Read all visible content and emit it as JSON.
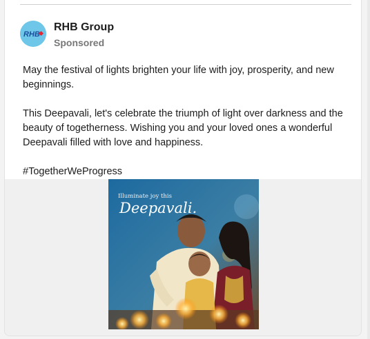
{
  "post": {
    "author": "RHB Group",
    "label": "Sponsored",
    "avatar_text": "RHB",
    "paragraphs": [
      "May the festival of lights brighten your life with joy, prosperity, and new beginnings.",
      "This Deepavali, let's celebrate the triumph of light over darkness and the beauty of togetherness. Wishing you and your loved ones a wonderful Deepavali filled with love and happiness.",
      "#TogetherWeProgress"
    ],
    "image": {
      "caption_small": "Illuminate joy this",
      "caption_large": "Deepavali."
    }
  },
  "colors": {
    "avatar_bg": "#6ec6e8",
    "brand_blue": "#1b4fa0",
    "brand_red": "#e3262f"
  }
}
